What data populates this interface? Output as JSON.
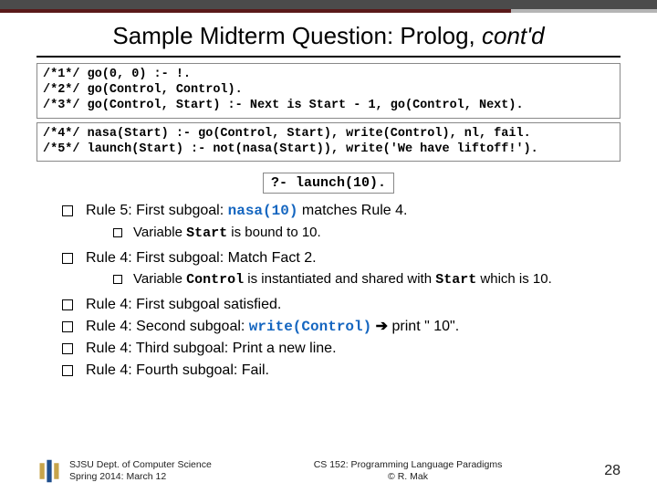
{
  "title_main": "Sample Midterm Question: Prolog, ",
  "title_italic": "cont'd",
  "code1": "/*1*/ go(0, 0) :- !.\n/*2*/ go(Control, Control).\n/*3*/ go(Control, Start) :- Next is Start - 1, go(Control, Next).",
  "code2": "/*4*/ nasa(Start) :- go(Control, Start), write(Control), nl, fail.\n/*5*/ launch(Start) :- not(nasa(Start)), write('We have liftoff!').",
  "query": "?- launch(10).",
  "bullets": {
    "b1_pre": "Rule 5: First subgoal: ",
    "b1_code": "nasa(10)",
    "b1_post": " matches Rule 4.",
    "b1_sub_pre": "Variable ",
    "b1_sub_code": "Start",
    "b1_sub_post": " is bound to 10.",
    "b2": "Rule 4: First subgoal: Match Fact 2.",
    "b2_sub_pre": "Variable ",
    "b2_sub_code1": "Control",
    "b2_sub_mid": " is instantiated and shared with ",
    "b2_sub_code2": "Start",
    "b2_sub_post": " which is 10.",
    "b3": "Rule 4: First subgoal satisfied.",
    "b4_pre": "Rule 4: Second subgoal: ",
    "b4_code": "write(Control)",
    "b4_arrow": " ➔ ",
    "b4_post": "print \" 10\".",
    "b5": "Rule 4: Third subgoal: Print a new line.",
    "b6": "Rule 4: Fourth subgoal: Fail."
  },
  "footer": {
    "dept1": "SJSU Dept. of Computer Science",
    "dept2": "Spring 2014: March 12",
    "mid1": "CS 152: Programming Language Paradigms",
    "mid2": "© R. Mak",
    "pagenum": "28"
  }
}
